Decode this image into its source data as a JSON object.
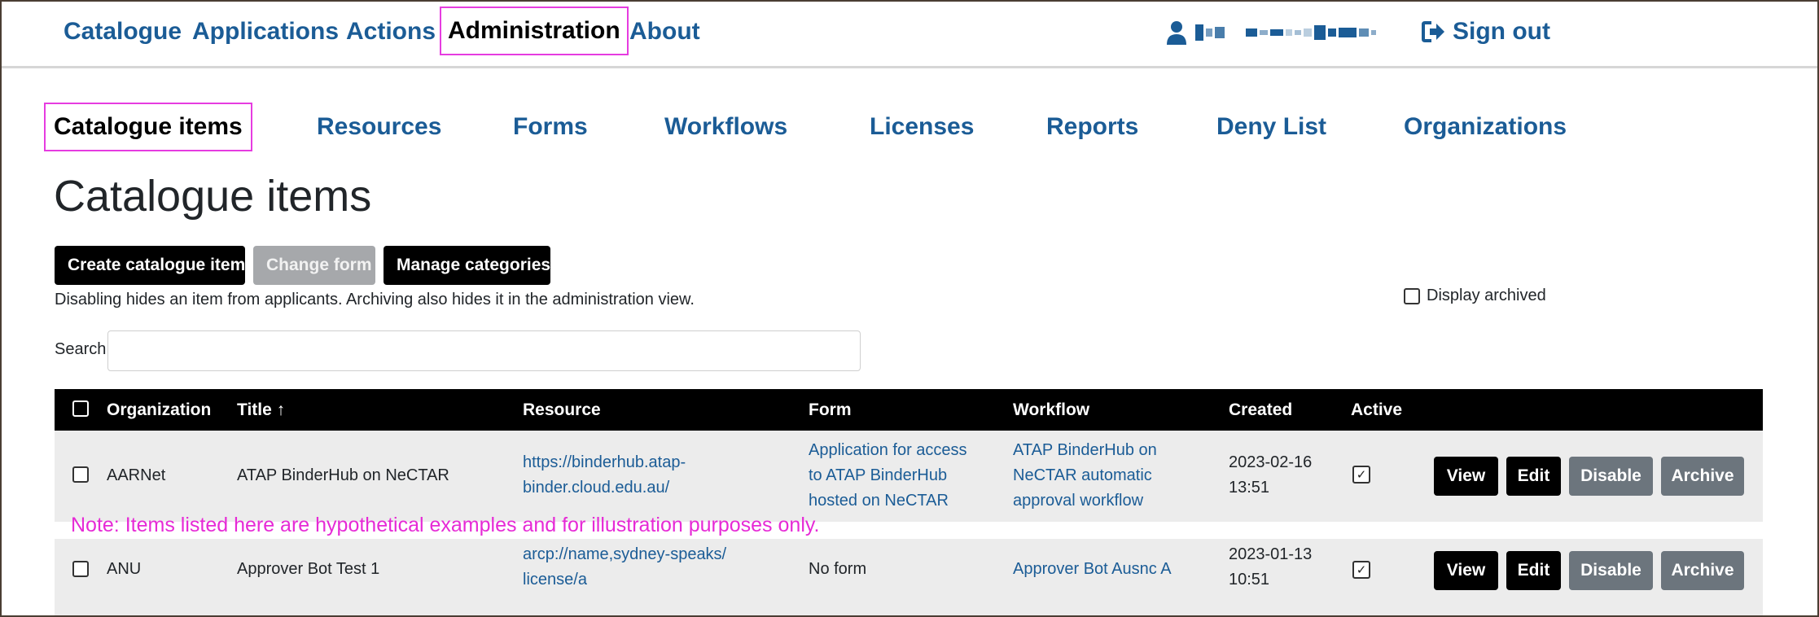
{
  "topnav": {
    "items": [
      "Catalogue",
      "Applications",
      "Actions",
      "Administration",
      "About"
    ],
    "active": "Administration",
    "sign_out": "Sign out"
  },
  "subnav": {
    "items": [
      "Catalogue items",
      "Resources",
      "Forms",
      "Workflows",
      "Licenses",
      "Reports",
      "Deny List",
      "Organizations"
    ],
    "active": "Catalogue items"
  },
  "page": {
    "title": "Catalogue items",
    "buttons": {
      "create": "Create catalogue item",
      "change_form": "Change form",
      "manage_categories": "Manage categories"
    },
    "help_text": "Disabling hides an item from applicants. Archiving also hides it in the administration view.",
    "display_archived": "Display archived",
    "search_label": "Search",
    "search_value": ""
  },
  "table": {
    "headers": [
      "Organization",
      "Title ↑",
      "Resource",
      "Form",
      "Workflow",
      "Created",
      "Active"
    ],
    "rows": [
      {
        "organization": "AARNet",
        "title": "ATAP BinderHub on NeCTAR",
        "resource": [
          "https://binderhub.atap-",
          "binder.cloud.edu.au/"
        ],
        "form": [
          "Application for access",
          "to ATAP BinderHub",
          "hosted on NeCTAR"
        ],
        "workflow": [
          "ATAP BinderHub on",
          "NeCTAR automatic",
          "approval workflow"
        ],
        "created": [
          "2023-02-16",
          "13:51"
        ],
        "active": true
      },
      {
        "organization": "ANU",
        "title": "Approver Bot Test 1",
        "resource": [
          "arcp://name,sydney-speaks/",
          "license/a"
        ],
        "form": [
          "No form"
        ],
        "workflow": [
          "Approver Bot Ausnc A"
        ],
        "created": [
          "2023-01-13",
          "10:51"
        ],
        "active": true
      }
    ],
    "row_actions": {
      "view": "View",
      "edit": "Edit",
      "disable": "Disable",
      "archive": "Archive"
    }
  },
  "note": "Note: Items listed here are hypothetical examples and for illustration purposes only.",
  "colors": {
    "link": "#1b5c96",
    "highlight": "#e63ce0",
    "note": "#e62ad6",
    "header_bg": "#000000",
    "row_bg": "#ececec"
  }
}
